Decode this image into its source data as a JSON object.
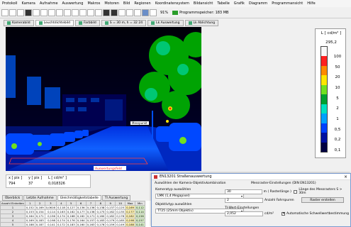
{
  "menu": [
    "Protokoll",
    "Kamera",
    "Aufnahme",
    "Auswertung",
    "Makros",
    "Motoren",
    "Bild",
    "Regionen",
    "Koordinatensystem",
    "Bildansicht",
    "Tabelle",
    "Grafik",
    "Diagramm",
    "Programmansicht",
    "Hilfe"
  ],
  "toolbar": {
    "zoom": "91%",
    "memory": "Programmspeicher: 183 MB"
  },
  "tabs": [
    "Kamerabild",
    "Leuchtdichtebild",
    "Farbbild",
    "S = 30 m, h = 32 24",
    "Lk Auswertung",
    "Lk Ablichtung"
  ],
  "image": {
    "label_region": "Messpunkt",
    "label_field": "Auswertungsfeld"
  },
  "status": {
    "h1": "x [ pix ]",
    "h2": "y [ pix ]",
    "h3": "L [ cd/m² ]",
    "v1": "794",
    "v2": "37",
    "v3": "0,018326"
  },
  "legend": {
    "title": "L [ cd/m² ]",
    "max": "295,2",
    "labels": [
      "100",
      "50",
      "20",
      "10",
      "5",
      "2",
      "1",
      "0,5",
      "0,2",
      "0,1"
    ],
    "colors": [
      "#f8f8f8",
      "#ff2020",
      "#ff8a00",
      "#ffe600",
      "#70e020",
      "#00a030",
      "#00e0c0",
      "#00a0ff",
      "#0040ff",
      "#0010a0",
      "#000040"
    ]
  },
  "bottom_tabs": [
    "Überblick",
    "Letzte Aufnahme",
    "Gleichmäßigkeitstabelle",
    "TI Auswertung"
  ],
  "table": {
    "headers": [
      "Anzahl Einheiten",
      "1",
      "2",
      "3",
      "4",
      "5",
      "6",
      "7",
      "8",
      "9",
      "10",
      "Max",
      "Min"
    ],
    "rows": [
      [
        "1",
        "0,152",
        "0,169",
        "0,0616",
        "0,118",
        "0,127",
        "0,136",
        "0,136",
        "0,138",
        "0,137",
        "0,125",
        "0,169",
        "0,112"
      ],
      [
        "2",
        "0,153",
        "0,154",
        "0,114",
        "0,163",
        "0,162",
        "0,177",
        "0,136",
        "0,175",
        "0,162",
        "0,135",
        "0,177",
        "0,114"
      ],
      [
        "3",
        "0,164",
        "0,171",
        "0,156",
        "0,174",
        "0,168",
        "0,162",
        "0,171",
        "0,160",
        "0,182",
        "0,178",
        "0,182",
        "0,156"
      ],
      [
        "4",
        "0,169",
        "0,183",
        "0,198",
        "0,174",
        "0,176",
        "0,164",
        "0,157",
        "0,183",
        "0,179",
        "0,185",
        "0,198",
        "0,157"
      ],
      [
        "5",
        "0,188",
        "0,187",
        "0,141",
        "0,172",
        "0,183",
        "0,160",
        "0,163",
        "0,176",
        "0,159",
        "0,149",
        "0,188",
        "0,141"
      ]
    ]
  },
  "dialog": {
    "title": "EN13201 Straßenauswertung",
    "head_left": "Auswählen der Kamera-Objektivkombination",
    "head_right": "Messraster-Einstellungen (DIN EN13201)",
    "camera_label": "Kameratyp auswählen",
    "camera_value": "LMK (1,4 Megapixel)",
    "lens_label": "Objektivtyp auswählen",
    "lens_value": "TT25 (25mm Objektiv)",
    "raster_value": "30",
    "raster_unit": "m ( Rasterlänge )",
    "length_check": "Länge des Messrasters S > 30m",
    "lanes_value": "2",
    "lanes_label": "Anzahl Fahrspuren",
    "raster_button": "Raster erstellen",
    "ti_label": "TI-Wert-Einstellungen",
    "ti_value": "2,052",
    "ti_unit": "cd/m²",
    "auto_check": "Automatische Schwellwertbestimmung"
  }
}
